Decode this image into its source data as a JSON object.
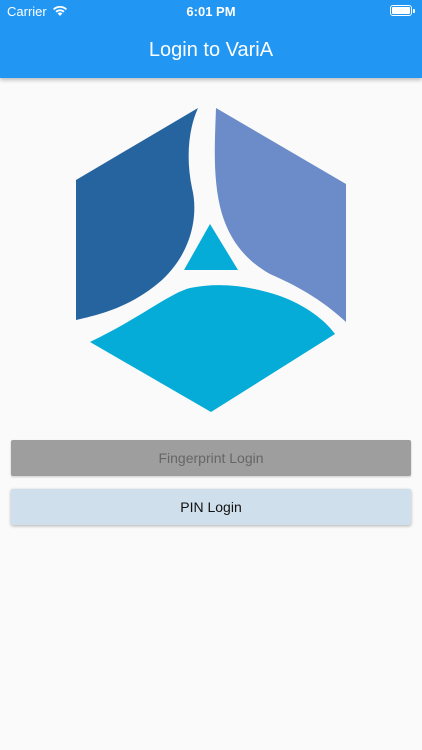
{
  "status_bar": {
    "carrier": "Carrier",
    "time": "6:01 PM",
    "icons": [
      "wifi-icon",
      "battery-icon"
    ]
  },
  "app_bar": {
    "title": "Login to VariA",
    "color": "#2196f3"
  },
  "logo": {
    "icon": "varia-logo",
    "colors": {
      "left_panel": "#25649f",
      "right_panel": "#6b8cc8",
      "bottom_panel": "#05acd8",
      "center_triangle": "#05acd8"
    }
  },
  "buttons": {
    "fingerprint_label": "Fingerprint Login",
    "pin_label": "PIN Login"
  }
}
